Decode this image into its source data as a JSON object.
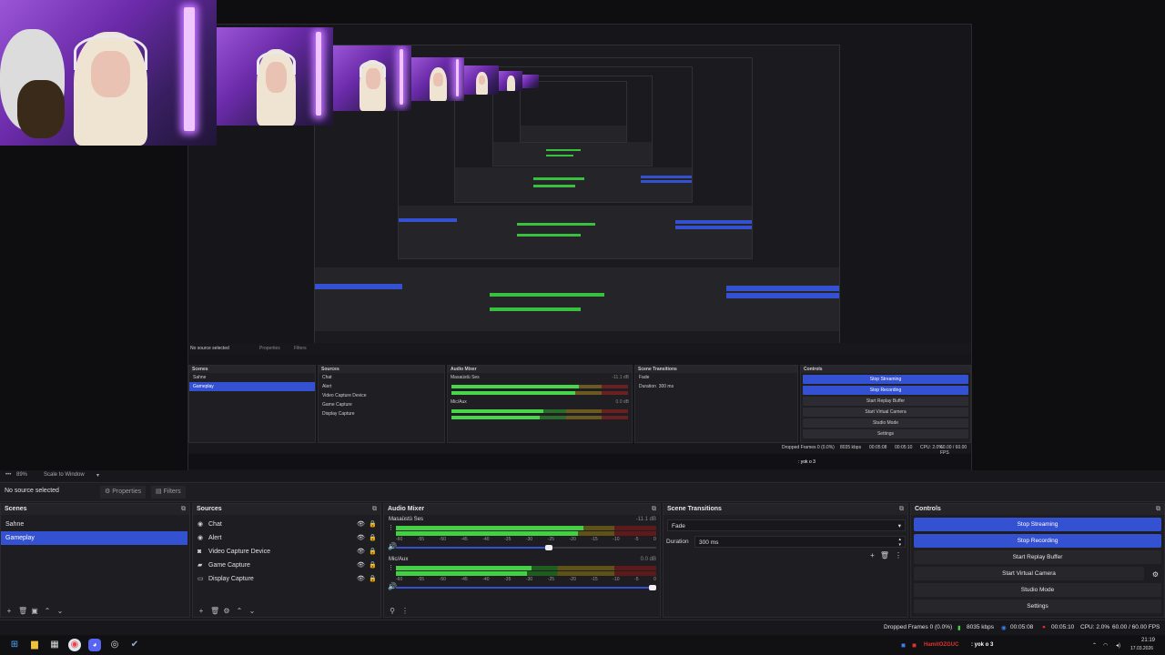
{
  "window": {
    "controls": [
      "─",
      "☐",
      "✕"
    ]
  },
  "preview": {
    "inner_scenes_header": "Scenes",
    "inner_sources_header": "Sources",
    "inner_mixer_header": "Audio Mixer",
    "inner_transitions_header": "Scene Transitions",
    "inner_controls_header": "Controls",
    "inner_no_source": "No source selected",
    "inner_properties": "Properties",
    "inner_filters": "Filters",
    "inner_scenes": [
      "Sahne",
      "Gameplay"
    ],
    "inner_sources": [
      "Chat",
      "Alert",
      "Video Capture Device",
      "Game Capture",
      "Display Capture"
    ],
    "inner_ch1": "Masaüstü Ses",
    "inner_ch1_db": "-11.1 dB",
    "inner_ch2": "Mic/Aux",
    "inner_ch2_db": "0.0 dB",
    "inner_transition": "Fade",
    "inner_duration_label": "Duration",
    "inner_duration": "300 ms",
    "inner_controls": [
      "Stop Streaming",
      "Stop Recording",
      "Start Replay Buffer",
      "Start Virtual Camera",
      "Studio Mode",
      "Settings"
    ],
    "inner_status": "Dropped Frames 0 (0.0%)",
    "inner_kbps": "8035 kbps",
    "inner_t1": "00:05:08",
    "inner_t2": "00:05:10",
    "inner_cpu": "CPU: 2.0%",
    "inner_fps": "60.00 / 60.00 FPS",
    "inner_scale_pct": "89%",
    "inner_scale_mode": "Scale to Window",
    "inner_chat": ": yok o 3"
  },
  "scalebar": {
    "percent": "89%",
    "mode": "Scale to Window"
  },
  "toolbar": {
    "no_source": "No source selected",
    "properties": "Properties",
    "filters": "Filters"
  },
  "scenes": {
    "title": "Scenes",
    "items": [
      "Sahne",
      "Gameplay"
    ],
    "selected": "Gameplay"
  },
  "sources": {
    "title": "Sources",
    "items": [
      {
        "label": "Chat",
        "icon": "browser-icon"
      },
      {
        "label": "Alert",
        "icon": "browser-icon"
      },
      {
        "label": "Video Capture Device",
        "icon": "camera-icon"
      },
      {
        "label": "Game Capture",
        "icon": "gamepad-icon"
      },
      {
        "label": "Display Capture",
        "icon": "monitor-icon"
      }
    ]
  },
  "mixer": {
    "title": "Audio Mixer",
    "channels": [
      {
        "name": "Masaüstü Ses",
        "db": "-11.1 dB",
        "level": 0.72,
        "volume": 0.6
      },
      {
        "name": "Mic/Aux",
        "db": "0.0 dB",
        "level": 0.52,
        "volume": 1.0
      }
    ],
    "ticks": [
      "-60",
      "-55",
      "-50",
      "-45",
      "-40",
      "-35",
      "-30",
      "-25",
      "-20",
      "-15",
      "-10",
      "-5",
      "0"
    ]
  },
  "transitions": {
    "title": "Scene Transitions",
    "transition": "Fade",
    "duration_label": "Duration",
    "duration": "300 ms"
  },
  "controls": {
    "title": "Controls",
    "buttons": [
      "Stop Streaming",
      "Stop Recording",
      "Start Replay Buffer",
      "Start Virtual Camera",
      "Studio Mode",
      "Settings"
    ]
  },
  "status": {
    "dropped": "Dropped Frames 0 (0.0%)",
    "kbps": "8035 kbps",
    "stream_time": "00:05:08",
    "rec_time": "00:05:10",
    "cpu": "CPU: 2.0%",
    "fps": "60.00 / 60.00 FPS"
  },
  "taskbar": {
    "chat_user": "HamitOZGUC",
    "chat_text": ": yok o 3",
    "time": "21:19",
    "date": "17.03.2026"
  },
  "colors": {
    "accent": "#3451d1",
    "meter_green": "#43d143",
    "record_red": "#e03030"
  }
}
